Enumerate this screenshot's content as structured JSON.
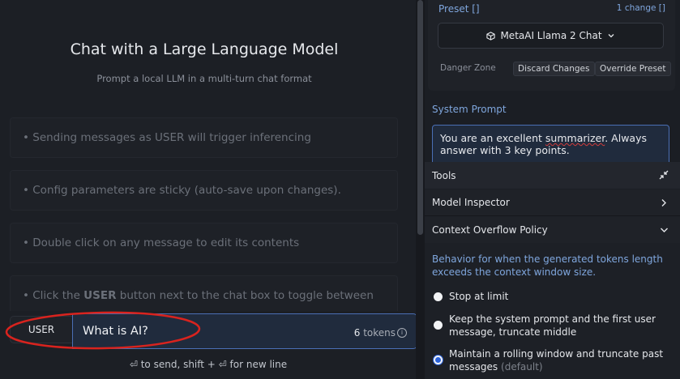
{
  "chat": {
    "title": "Chat with a Large Language Model",
    "subtitle": "Prompt a local LLM in a multi-turn chat format",
    "hints": [
      "• Sending messages as USER will trigger inferencing",
      "• Config parameters are sticky (auto-save upon changes).",
      "• Double click on any message to edit its contents",
      "• Click the USER button next to the chat box to toggle between"
    ],
    "role_button": "USER",
    "message_value": "What is AI?",
    "token_count": "6",
    "token_label": "tokens",
    "send_hint": "⏎ to send, shift + ⏎ for new line"
  },
  "preset": {
    "label": "Preset []",
    "change_link": "1 change []",
    "selected": "MetaAI Llama 2 Chat",
    "danger_label": "Danger Zone",
    "discard_label": "Discard Changes",
    "override_label": "Override Preset"
  },
  "system_prompt": {
    "label": "System Prompt",
    "text_before": "You are an excellent ",
    "text_flagged": "summarizer",
    "text_after": ". Always answer with 3 key points."
  },
  "tools": {
    "label": "Tools",
    "model_inspector": "Model Inspector",
    "context_overflow": "Context Overflow Policy",
    "description": "Behavior for when the generated tokens length exceeds the context window size.",
    "options": [
      {
        "label": "Stop at limit",
        "suffix": "",
        "selected": false
      },
      {
        "label": "Keep the system prompt and the first user message, truncate middle",
        "suffix": "",
        "selected": false
      },
      {
        "label": "Maintain a rolling window and truncate past messages",
        "suffix": "(default)",
        "selected": true
      }
    ]
  },
  "colors": {
    "accent": "#7fa6dd",
    "input_border": "#4a6fb5",
    "annotation_red": "#d9231e",
    "radio_selected": "#2b62d9"
  }
}
